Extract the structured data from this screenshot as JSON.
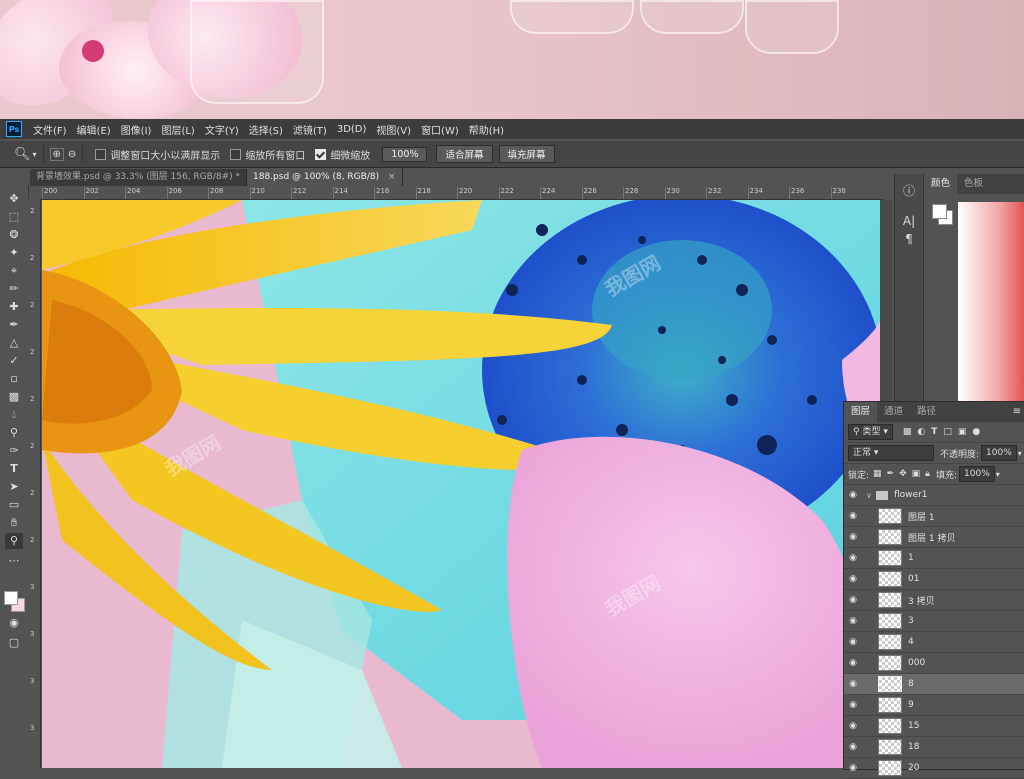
{
  "menubar": {
    "logo": "Ps",
    "items": [
      "文件(F)",
      "编辑(E)",
      "图像(I)",
      "图层(L)",
      "文字(Y)",
      "选择(S)",
      "滤镜(T)",
      "3D(D)",
      "视图(V)",
      "窗口(W)",
      "帮助(H)"
    ]
  },
  "options": {
    "resize_label": "调整窗口大小以满屏显示",
    "zoom_all_label": "缩放所有窗口",
    "scrubby_label": "细微缩放",
    "zoom_value": "100%",
    "fit_screen": "适合屏幕",
    "fill_screen": "填充屏幕"
  },
  "tabs": [
    {
      "label": "背景墙效果.psd @ 33.3% (图层 156, RGB/8#) *",
      "active": false
    },
    {
      "label": "188.psd @ 100% (8, RGB/8)",
      "active": true
    }
  ],
  "ruler_top": [
    "200",
    "202",
    "204",
    "206",
    "208",
    "210",
    "212",
    "214",
    "216",
    "218",
    "220",
    "222",
    "224",
    "226",
    "228",
    "230",
    "232",
    "234",
    "236",
    "238"
  ],
  "ruler_left": [
    "2",
    "2",
    "2",
    "2",
    "2",
    "2",
    "2",
    "2",
    "3",
    "3",
    "3",
    "3"
  ],
  "color_panel": {
    "tabs": [
      "颜色",
      "色板"
    ]
  },
  "layers_panel": {
    "tabs": [
      "图层",
      "通道",
      "路径"
    ],
    "kind_filter": "类型",
    "blend_mode": "正常",
    "opacity_label": "不透明度:",
    "opacity_value": "100%",
    "lock_label": "锁定:",
    "fill_label": "填充:",
    "fill_value": "100%",
    "group_name": "flower1",
    "layers": [
      "图层 1",
      "图层 1 拷贝",
      "1",
      "01",
      "3 拷贝",
      "3",
      "4",
      "000",
      "8",
      "9",
      "15",
      "18",
      "20"
    ],
    "selected": "8"
  },
  "watermark": "我图网"
}
